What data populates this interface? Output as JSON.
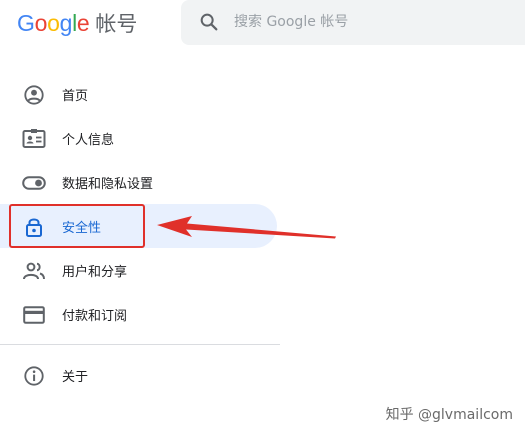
{
  "header": {
    "logo": {
      "word": "Google",
      "letters": [
        {
          "ch": "G",
          "color": "#4285F4"
        },
        {
          "ch": "o",
          "color": "#EA4335"
        },
        {
          "ch": "o",
          "color": "#FBBC05"
        },
        {
          "ch": "g",
          "color": "#4285F4"
        },
        {
          "ch": "l",
          "color": "#34A853"
        },
        {
          "ch": "e",
          "color": "#EA4335"
        }
      ],
      "suffix": "帐号"
    },
    "search": {
      "placeholder": "搜索 Google 帐号",
      "value": "",
      "icon": "search-icon"
    }
  },
  "nav": {
    "items": [
      {
        "id": "home",
        "label": "首页",
        "icon": "account-circle-icon",
        "active": false
      },
      {
        "id": "personal-info",
        "label": "个人信息",
        "icon": "id-card-icon",
        "active": false
      },
      {
        "id": "data-privacy",
        "label": "数据和隐私设置",
        "icon": "toggle-icon",
        "active": false
      },
      {
        "id": "security",
        "label": "安全性",
        "icon": "lock-icon",
        "active": true
      },
      {
        "id": "people-sharing",
        "label": "用户和分享",
        "icon": "people-icon",
        "active": false
      },
      {
        "id": "payments",
        "label": "付款和订阅",
        "icon": "credit-card-icon",
        "active": false
      }
    ],
    "footer_items": [
      {
        "id": "about",
        "label": "关于",
        "icon": "info-icon",
        "active": false
      }
    ]
  },
  "colors": {
    "active_bg": "#e8f0fe",
    "active_text": "#1967d2",
    "annotation_red": "#e0302a",
    "icon_gray": "#5f6368"
  },
  "watermark": "知乎 @glvmailcom"
}
